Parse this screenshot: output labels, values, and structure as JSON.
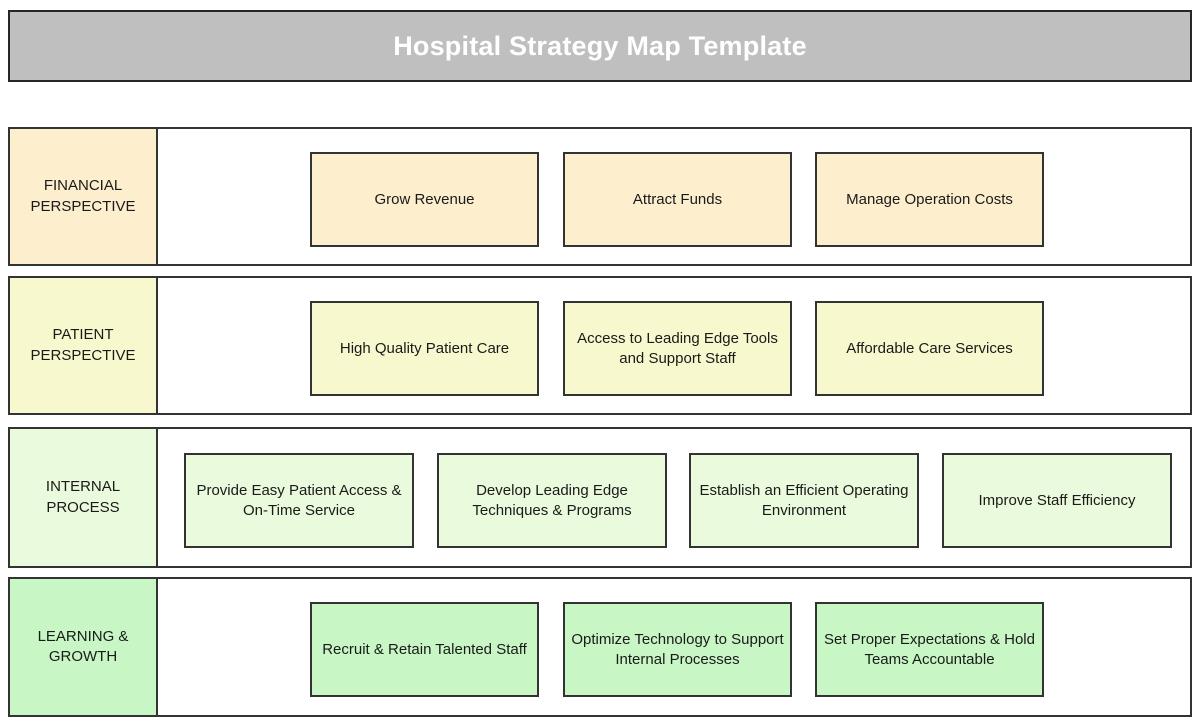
{
  "title": {
    "text": "Hospital Strategy Map Template",
    "background_color": "#BFBFBF",
    "text_color": "#FFFFFF"
  },
  "colors": {
    "financial": "#FDEFCE",
    "patient": "#F7F8CE",
    "internal": "#EAFADC",
    "learning": "#C8F7C5",
    "border": "#333333"
  },
  "perspectives": [
    {
      "label": "FINANCIAL\nPERSPECTIVE",
      "label_line1": "FINANCIAL",
      "label_line2": "PERSPECTIVE",
      "fill": "#FDEFCE",
      "objectives": [
        {
          "text": "Grow Revenue"
        },
        {
          "text": "Attract Funds"
        },
        {
          "text": "Manage Operation Costs"
        }
      ]
    },
    {
      "label": "PATIENT\nPERSPECTIVE",
      "label_line1": "PATIENT",
      "label_line2": "PERSPECTIVE",
      "fill": "#F7F8CE",
      "objectives": [
        {
          "text": "High Quality Patient Care"
        },
        {
          "text": "Access to Leading Edge Tools and Support Staff"
        },
        {
          "text": "Affordable Care Services"
        }
      ]
    },
    {
      "label": "INTERNAL\nPROCESS",
      "label_line1": "INTERNAL",
      "label_line2": "PROCESS",
      "fill": "#EAFADC",
      "objectives": [
        {
          "text": "Provide Easy Patient Access & On-Time Service"
        },
        {
          "text": "Develop Leading Edge Techniques & Programs"
        },
        {
          "text": "Establish an Efficient Operating Environment"
        },
        {
          "text": "Improve Staff Efficiency"
        }
      ]
    },
    {
      "label": "LEARNING &\nGROWTH",
      "label_line1": "LEARNING &",
      "label_line2": "GROWTH",
      "fill": "#C8F7C5",
      "objectives": [
        {
          "text": "Recruit & Retain Talented Staff"
        },
        {
          "text": "Optimize Technology to Support Internal Processes"
        },
        {
          "text": "Set Proper Expectations & Hold Teams Accountable"
        }
      ]
    }
  ]
}
